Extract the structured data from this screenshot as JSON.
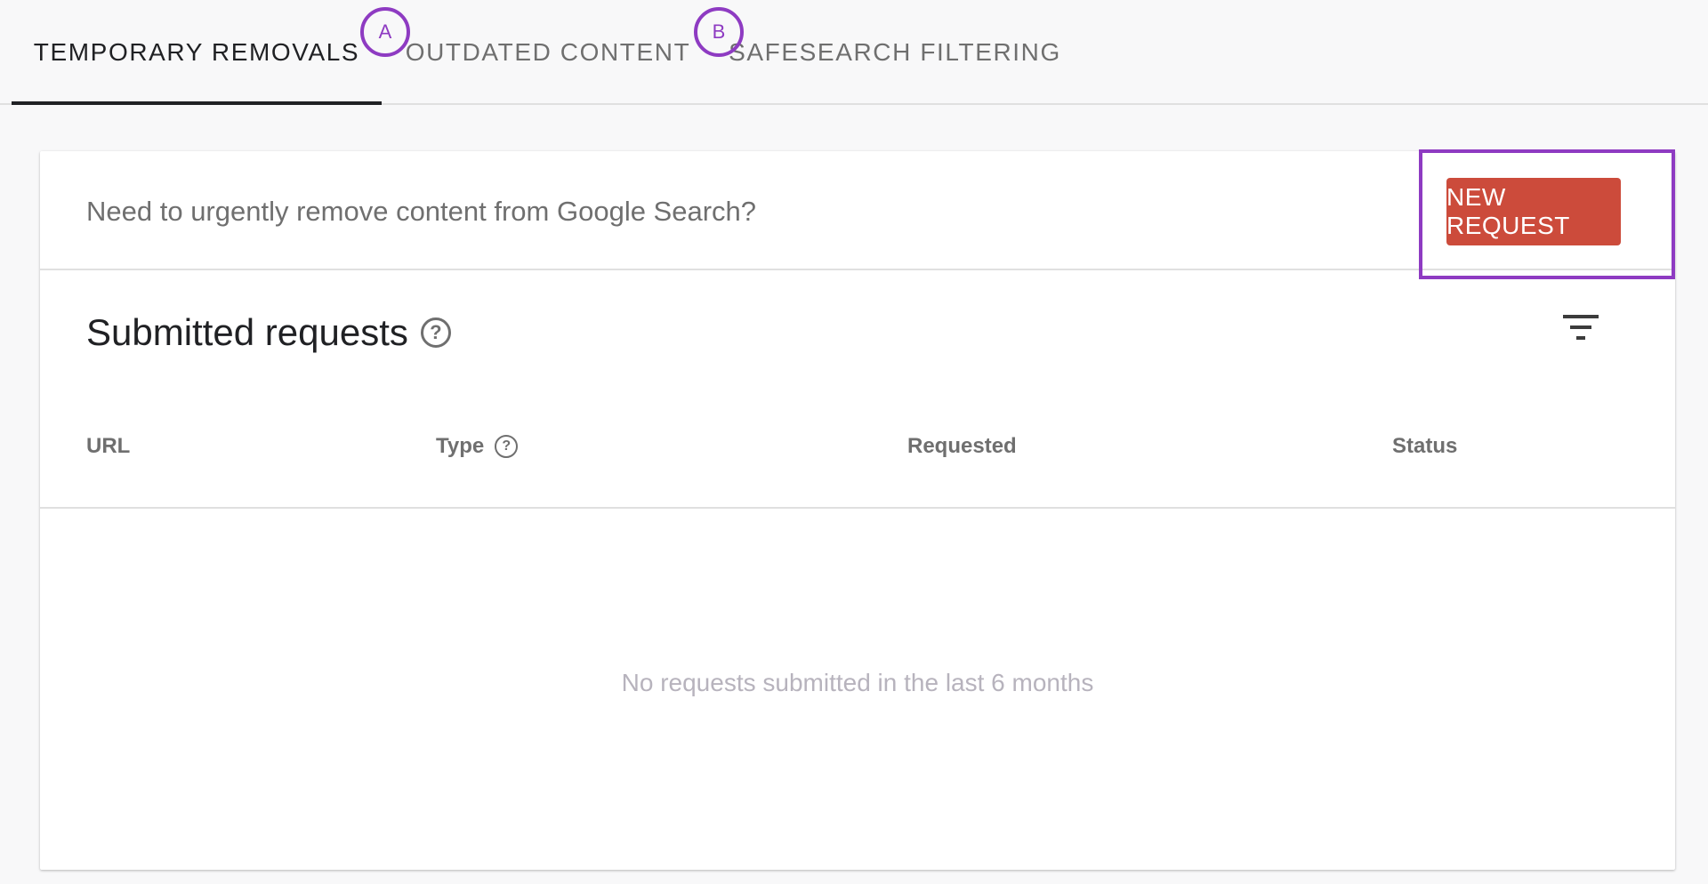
{
  "tabs": [
    {
      "label": "TEMPORARY REMOVALS",
      "active": true
    },
    {
      "label": "OUTDATED CONTENT",
      "active": false
    },
    {
      "label": "SAFESEARCH FILTERING",
      "active": false
    }
  ],
  "annotations": {
    "a": "A",
    "b": "B"
  },
  "card": {
    "prompt": "Need to urgently remove content from Google Search?",
    "new_request_label": "NEW REQUEST",
    "section_title": "Submitted requests",
    "columns": {
      "url": "URL",
      "type": "Type",
      "requested": "Requested",
      "status": "Status"
    },
    "empty_message": "No requests submitted in the last 6 months"
  },
  "colors": {
    "accent_button": "#cc4b3b",
    "annotation": "#8e3bc2"
  },
  "icons": {
    "help": "help-circle-icon",
    "filter": "filter-icon"
  }
}
